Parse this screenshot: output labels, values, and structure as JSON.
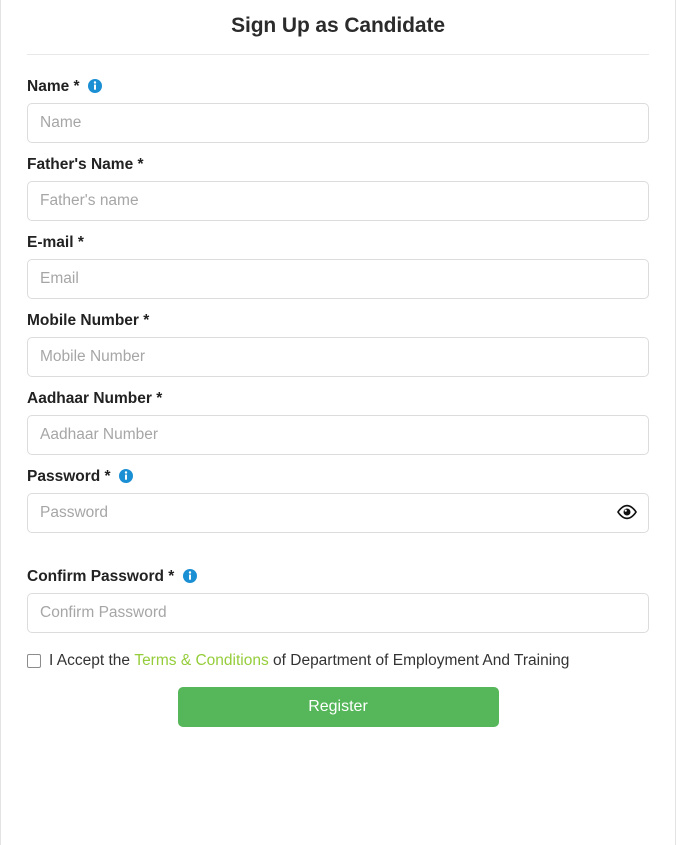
{
  "form": {
    "title": "Sign Up as Candidate",
    "fields": [
      {
        "label": "Name *",
        "placeholder": "Name",
        "name": "name",
        "has_info_icon": true,
        "info_icon": "info-icon",
        "value": ""
      },
      {
        "label": "Father's Name *",
        "placeholder": "Father's name",
        "name": "fathers-name",
        "has_info_icon": false,
        "value": ""
      },
      {
        "label": "E-mail *",
        "placeholder": "Email",
        "name": "email",
        "has_info_icon": false,
        "value": ""
      },
      {
        "label": "Mobile Number *",
        "placeholder": "Mobile Number",
        "name": "mobile-number",
        "has_info_icon": false,
        "value": ""
      },
      {
        "label": "Aadhaar Number *",
        "placeholder": "Aadhaar Number",
        "name": "aadhaar-number",
        "has_info_icon": false,
        "value": ""
      },
      {
        "label": "Password *",
        "placeholder": "Password",
        "name": "password",
        "has_info_icon": true,
        "info_icon": "info-icon",
        "toggle_icon": "eye-icon",
        "value": ""
      },
      {
        "label": "Confirm Password *",
        "placeholder": "Confirm Password",
        "name": "confirm-password",
        "has_info_icon": true,
        "info_icon": "info-icon",
        "value": ""
      }
    ],
    "terms": {
      "checked": false,
      "text_before": "I Accept the",
      "link_label": "Terms & Conditions",
      "text_after": "of Department of Employment And Training"
    },
    "submit_label": "Register"
  },
  "colors": {
    "title_text": "#2b2b2b",
    "label_text": "#222222",
    "placeholder": "#a6a6a6",
    "input_border": "#dcdcdc",
    "info_icon_blue": "#1b8fd4",
    "terms_link_green": "#95cd3a",
    "register_button_green": "#55b65a",
    "card_border": "#e3e3e3"
  }
}
